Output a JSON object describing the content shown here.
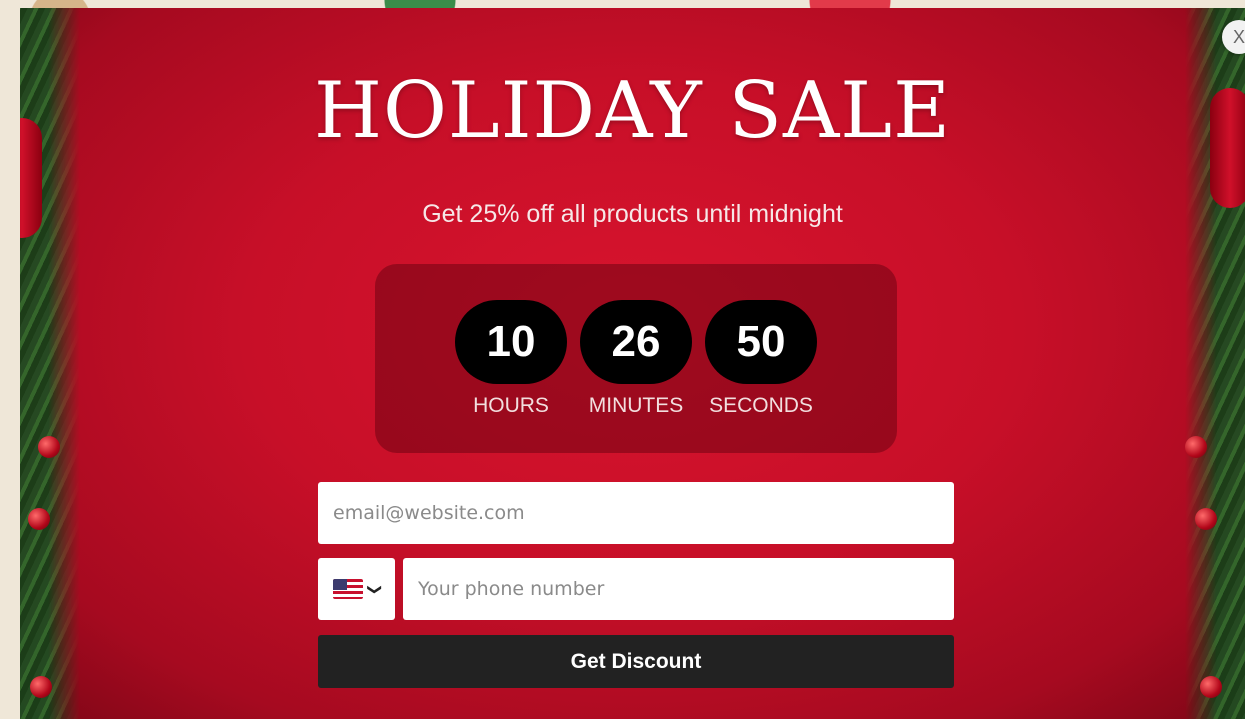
{
  "popup": {
    "title": "HOLIDAY SALE",
    "subtitle": "Get 25% off all products until midnight",
    "close_label": "X",
    "countdown": [
      {
        "value": "10",
        "label": "HOURS"
      },
      {
        "value": "26",
        "label": "MINUTES"
      },
      {
        "value": "50",
        "label": "SECONDS"
      }
    ],
    "email": {
      "placeholder": "email@website.com",
      "value": ""
    },
    "phone": {
      "placeholder": "Your phone number",
      "value": "",
      "country_flag": "us-flag-icon"
    },
    "cta_label": "Get Discount",
    "colors": {
      "background": "#c70f28",
      "button": "#222222",
      "pill": "#000000"
    }
  }
}
